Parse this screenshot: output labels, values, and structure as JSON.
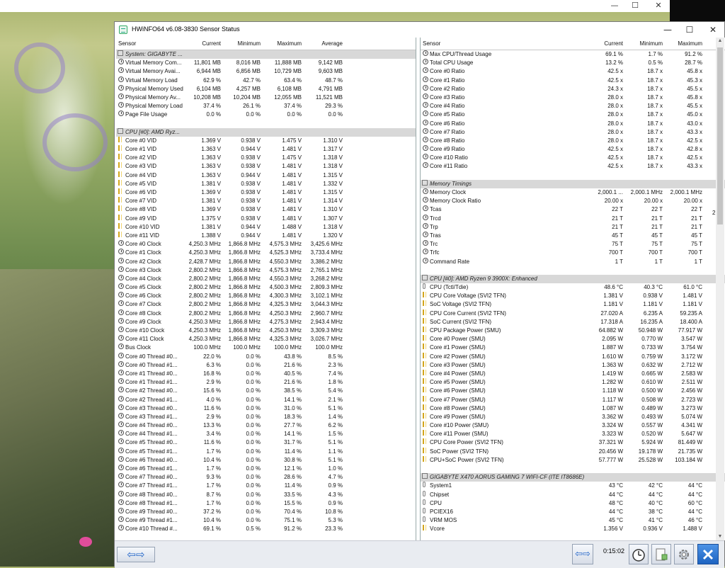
{
  "desktop": {
    "min_glyph": "—",
    "max_glyph": "☐",
    "close_glyph": "✕"
  },
  "window": {
    "title": "HWiNFO64 v6.08-3830 Sensor Status",
    "min_glyph": "—",
    "max_glyph": "☐",
    "close_glyph": "✕"
  },
  "left_pane": {
    "columns": [
      "Sensor",
      "Current",
      "Minimum",
      "Maximum",
      "Average"
    ],
    "rows": [
      {
        "type": "group",
        "label": "System: GIGABYTE ..."
      },
      {
        "icon": "clock-icon",
        "name": "Virtual Memory Com...",
        "cur": "11,801 MB",
        "min": "8,016 MB",
        "max": "11,888 MB",
        "avg": "9,142 MB"
      },
      {
        "icon": "clock-icon",
        "name": "Virtual Memory Avai...",
        "cur": "6,944 MB",
        "min": "6,856 MB",
        "max": "10,729 MB",
        "avg": "9,603 MB"
      },
      {
        "icon": "clock-icon",
        "name": "Virtual Memory Load",
        "cur": "62.9 %",
        "min": "42.7 %",
        "max": "63.4 %",
        "avg": "48.7 %"
      },
      {
        "icon": "clock-icon",
        "name": "Physical Memory Used",
        "cur": "6,104 MB",
        "min": "4,257 MB",
        "max": "6,108 MB",
        "avg": "4,791 MB"
      },
      {
        "icon": "clock-icon",
        "name": "Physical Memory Av...",
        "cur": "10,208 MB",
        "min": "10,204 MB",
        "max": "12,055 MB",
        "avg": "11,521 MB"
      },
      {
        "icon": "clock-icon",
        "name": "Physical Memory Load",
        "cur": "37.4 %",
        "min": "26.1 %",
        "max": "37.4 %",
        "avg": "29.3 %"
      },
      {
        "icon": "clock-icon",
        "name": "Page File Usage",
        "cur": "0.0 %",
        "min": "0.0 %",
        "max": "0.0 %",
        "avg": "0.0 %"
      },
      {
        "type": "blank"
      },
      {
        "type": "group",
        "label": "CPU [#0]: AMD Ryz..."
      },
      {
        "icon": "volt-icon",
        "name": "Core #0 VID",
        "cur": "1.369 V",
        "min": "0.938 V",
        "max": "1.475 V",
        "avg": "1.310 V"
      },
      {
        "icon": "volt-icon",
        "name": "Core #1 VID",
        "cur": "1.363 V",
        "min": "0.944 V",
        "max": "1.481 V",
        "avg": "1.317 V"
      },
      {
        "icon": "volt-icon",
        "name": "Core #2 VID",
        "cur": "1.363 V",
        "min": "0.938 V",
        "max": "1.475 V",
        "avg": "1.318 V"
      },
      {
        "icon": "volt-icon",
        "name": "Core #3 VID",
        "cur": "1.363 V",
        "min": "0.938 V",
        "max": "1.481 V",
        "avg": "1.318 V"
      },
      {
        "icon": "volt-icon",
        "name": "Core #4 VID",
        "cur": "1.363 V",
        "min": "0.944 V",
        "max": "1.481 V",
        "avg": "1.315 V"
      },
      {
        "icon": "volt-icon",
        "name": "Core #5 VID",
        "cur": "1.381 V",
        "min": "0.938 V",
        "max": "1.481 V",
        "avg": "1.332 V"
      },
      {
        "icon": "volt-icon",
        "name": "Core #6 VID",
        "cur": "1.369 V",
        "min": "0.938 V",
        "max": "1.481 V",
        "avg": "1.315 V"
      },
      {
        "icon": "volt-icon",
        "name": "Core #7 VID",
        "cur": "1.381 V",
        "min": "0.938 V",
        "max": "1.481 V",
        "avg": "1.314 V"
      },
      {
        "icon": "volt-icon",
        "name": "Core #8 VID",
        "cur": "1.369 V",
        "min": "0.938 V",
        "max": "1.481 V",
        "avg": "1.310 V"
      },
      {
        "icon": "volt-icon",
        "name": "Core #9 VID",
        "cur": "1.375 V",
        "min": "0.938 V",
        "max": "1.481 V",
        "avg": "1.307 V"
      },
      {
        "icon": "volt-icon",
        "name": "Core #10 VID",
        "cur": "1.381 V",
        "min": "0.944 V",
        "max": "1.488 V",
        "avg": "1.318 V"
      },
      {
        "icon": "volt-icon",
        "name": "Core #11 VID",
        "cur": "1.388 V",
        "min": "0.944 V",
        "max": "1.481 V",
        "avg": "1.320 V"
      },
      {
        "icon": "clock-icon",
        "name": "Core #0 Clock",
        "cur": "4,250.3 MHz",
        "min": "1,866.8 MHz",
        "max": "4,575.3 MHz",
        "avg": "3,425.6 MHz"
      },
      {
        "icon": "clock-icon",
        "name": "Core #1 Clock",
        "cur": "4,250.3 MHz",
        "min": "1,866.8 MHz",
        "max": "4,525.3 MHz",
        "avg": "3,733.4 MHz"
      },
      {
        "icon": "clock-icon",
        "name": "Core #2 Clock",
        "cur": "2,428.7 MHz",
        "min": "1,866.8 MHz",
        "max": "4,550.3 MHz",
        "avg": "3,386.2 MHz"
      },
      {
        "icon": "clock-icon",
        "name": "Core #3 Clock",
        "cur": "2,800.2 MHz",
        "min": "1,866.8 MHz",
        "max": "4,575.3 MHz",
        "avg": "2,765.1 MHz"
      },
      {
        "icon": "clock-icon",
        "name": "Core #4 Clock",
        "cur": "2,800.2 MHz",
        "min": "1,866.8 MHz",
        "max": "4,550.3 MHz",
        "avg": "3,268.2 MHz"
      },
      {
        "icon": "clock-icon",
        "name": "Core #5 Clock",
        "cur": "2,800.2 MHz",
        "min": "1,866.8 MHz",
        "max": "4,500.3 MHz",
        "avg": "2,809.3 MHz"
      },
      {
        "icon": "clock-icon",
        "name": "Core #6 Clock",
        "cur": "2,800.2 MHz",
        "min": "1,866.8 MHz",
        "max": "4,300.3 MHz",
        "avg": "3,102.1 MHz"
      },
      {
        "icon": "clock-icon",
        "name": "Core #7 Clock",
        "cur": "2,800.2 MHz",
        "min": "1,866.8 MHz",
        "max": "4,325.3 MHz",
        "avg": "3,044.3 MHz"
      },
      {
        "icon": "clock-icon",
        "name": "Core #8 Clock",
        "cur": "2,800.2 MHz",
        "min": "1,866.8 MHz",
        "max": "4,250.3 MHz",
        "avg": "2,960.7 MHz"
      },
      {
        "icon": "clock-icon",
        "name": "Core #9 Clock",
        "cur": "4,250.3 MHz",
        "min": "1,866.8 MHz",
        "max": "4,275.3 MHz",
        "avg": "2,943.4 MHz"
      },
      {
        "icon": "clock-icon",
        "name": "Core #10 Clock",
        "cur": "4,250.3 MHz",
        "min": "1,866.8 MHz",
        "max": "4,250.3 MHz",
        "avg": "3,309.3 MHz"
      },
      {
        "icon": "clock-icon",
        "name": "Core #11 Clock",
        "cur": "4,250.3 MHz",
        "min": "1,866.8 MHz",
        "max": "4,325.3 MHz",
        "avg": "3,026.7 MHz"
      },
      {
        "icon": "clock-icon",
        "name": "Bus Clock",
        "cur": "100.0 MHz",
        "min": "100.0 MHz",
        "max": "100.0 MHz",
        "avg": "100.0 MHz"
      },
      {
        "icon": "clock-icon",
        "name": "Core #0 Thread #0...",
        "cur": "22.0 %",
        "min": "0.0 %",
        "max": "43.8 %",
        "avg": "8.5 %"
      },
      {
        "icon": "clock-icon",
        "name": "Core #0 Thread #1...",
        "cur": "6.3 %",
        "min": "0.0 %",
        "max": "21.6 %",
        "avg": "2.3 %"
      },
      {
        "icon": "clock-icon",
        "name": "Core #1 Thread #0...",
        "cur": "16.8 %",
        "min": "0.0 %",
        "max": "40.5 %",
        "avg": "7.4 %"
      },
      {
        "icon": "clock-icon",
        "name": "Core #1 Thread #1...",
        "cur": "2.9 %",
        "min": "0.0 %",
        "max": "21.6 %",
        "avg": "1.8 %"
      },
      {
        "icon": "clock-icon",
        "name": "Core #2 Thread #0...",
        "cur": "15.6 %",
        "min": "0.0 %",
        "max": "38.5 %",
        "avg": "5.4 %"
      },
      {
        "icon": "clock-icon",
        "name": "Core #2 Thread #1...",
        "cur": "4.0 %",
        "min": "0.0 %",
        "max": "14.1 %",
        "avg": "2.1 %"
      },
      {
        "icon": "clock-icon",
        "name": "Core #3 Thread #0...",
        "cur": "11.6 %",
        "min": "0.0 %",
        "max": "31.0 %",
        "avg": "5.1 %"
      },
      {
        "icon": "clock-icon",
        "name": "Core #3 Thread #1...",
        "cur": "2.9 %",
        "min": "0.0 %",
        "max": "18.3 %",
        "avg": "1.4 %"
      },
      {
        "icon": "clock-icon",
        "name": "Core #4 Thread #0...",
        "cur": "13.3 %",
        "min": "0.0 %",
        "max": "27.7 %",
        "avg": "6.2 %"
      },
      {
        "icon": "clock-icon",
        "name": "Core #4 Thread #1...",
        "cur": "3.4 %",
        "min": "0.0 %",
        "max": "14.1 %",
        "avg": "1.5 %"
      },
      {
        "icon": "clock-icon",
        "name": "Core #5 Thread #0...",
        "cur": "11.6 %",
        "min": "0.0 %",
        "max": "31.7 %",
        "avg": "5.1 %"
      },
      {
        "icon": "clock-icon",
        "name": "Core #5 Thread #1...",
        "cur": "1.7 %",
        "min": "0.0 %",
        "max": "11.4 %",
        "avg": "1.1 %"
      },
      {
        "icon": "clock-icon",
        "name": "Core #6 Thread #0...",
        "cur": "10.4 %",
        "min": "0.0 %",
        "max": "30.8 %",
        "avg": "5.1 %"
      },
      {
        "icon": "clock-icon",
        "name": "Core #6 Thread #1...",
        "cur": "1.7 %",
        "min": "0.0 %",
        "max": "12.1 %",
        "avg": "1.0 %"
      },
      {
        "icon": "clock-icon",
        "name": "Core #7 Thread #0...",
        "cur": "9.3 %",
        "min": "0.0 %",
        "max": "28.6 %",
        "avg": "4.7 %"
      },
      {
        "icon": "clock-icon",
        "name": "Core #7 Thread #1...",
        "cur": "1.7 %",
        "min": "0.0 %",
        "max": "11.4 %",
        "avg": "0.9 %"
      },
      {
        "icon": "clock-icon",
        "name": "Core #8 Thread #0...",
        "cur": "8.7 %",
        "min": "0.0 %",
        "max": "33.5 %",
        "avg": "4.3 %"
      },
      {
        "icon": "clock-icon",
        "name": "Core #8 Thread #1...",
        "cur": "1.7 %",
        "min": "0.0 %",
        "max": "15.5 %",
        "avg": "0.9 %"
      },
      {
        "icon": "clock-icon",
        "name": "Core #9 Thread #0...",
        "cur": "37.2 %",
        "min": "0.0 %",
        "max": "70.4 %",
        "avg": "10.8 %"
      },
      {
        "icon": "clock-icon",
        "name": "Core #9 Thread #1...",
        "cur": "10.4 %",
        "min": "0.0 %",
        "max": "75.1 %",
        "avg": "5.3 %"
      },
      {
        "icon": "clock-icon",
        "name": "Core #10 Thread #...",
        "cur": "69.1 %",
        "min": "0.5 %",
        "max": "91.2 %",
        "avg": "23.3 %"
      }
    ]
  },
  "right_pane": {
    "columns": [
      "Sensor",
      "Current",
      "Minimum",
      "Maximum"
    ],
    "rows": [
      {
        "icon": "clock-icon",
        "name": "Max CPU/Thread Usage",
        "cur": "69.1 %",
        "min": "1.7 %",
        "max": "91.2 %"
      },
      {
        "icon": "clock-icon",
        "name": "Total CPU Usage",
        "cur": "13.2 %",
        "min": "0.5 %",
        "max": "28.7 %"
      },
      {
        "icon": "clock-icon",
        "name": "Core #0 Ratio",
        "cur": "42.5 x",
        "min": "18.7 x",
        "max": "45.8 x"
      },
      {
        "icon": "clock-icon",
        "name": "Core #1 Ratio",
        "cur": "42.5 x",
        "min": "18.7 x",
        "max": "45.3 x"
      },
      {
        "icon": "clock-icon",
        "name": "Core #2 Ratio",
        "cur": "24.3 x",
        "min": "18.7 x",
        "max": "45.5 x"
      },
      {
        "icon": "clock-icon",
        "name": "Core #3 Ratio",
        "cur": "28.0 x",
        "min": "18.7 x",
        "max": "45.8 x"
      },
      {
        "icon": "clock-icon",
        "name": "Core #4 Ratio",
        "cur": "28.0 x",
        "min": "18.7 x",
        "max": "45.5 x"
      },
      {
        "icon": "clock-icon",
        "name": "Core #5 Ratio",
        "cur": "28.0 x",
        "min": "18.7 x",
        "max": "45.0 x"
      },
      {
        "icon": "clock-icon",
        "name": "Core #6 Ratio",
        "cur": "28.0 x",
        "min": "18.7 x",
        "max": "43.0 x"
      },
      {
        "icon": "clock-icon",
        "name": "Core #7 Ratio",
        "cur": "28.0 x",
        "min": "18.7 x",
        "max": "43.3 x"
      },
      {
        "icon": "clock-icon",
        "name": "Core #8 Ratio",
        "cur": "28.0 x",
        "min": "18.7 x",
        "max": "42.5 x"
      },
      {
        "icon": "clock-icon",
        "name": "Core #9 Ratio",
        "cur": "42.5 x",
        "min": "18.7 x",
        "max": "42.8 x"
      },
      {
        "icon": "clock-icon",
        "name": "Core #10 Ratio",
        "cur": "42.5 x",
        "min": "18.7 x",
        "max": "42.5 x"
      },
      {
        "icon": "clock-icon",
        "name": "Core #11 Ratio",
        "cur": "42.5 x",
        "min": "18.7 x",
        "max": "43.3 x"
      },
      {
        "type": "blank"
      },
      {
        "type": "group",
        "label": "Memory Timings"
      },
      {
        "icon": "clock-icon",
        "name": "Memory Clock",
        "cur": "2,000.1 ...",
        "min": "2,000.1 MHz",
        "max": "2,000.1 MHz"
      },
      {
        "icon": "clock-icon",
        "name": "Memory Clock Ratio",
        "cur": "20.00 x",
        "min": "20.00 x",
        "max": "20.00 x"
      },
      {
        "icon": "clock-icon",
        "name": "Tcas",
        "cur": "22 T",
        "min": "22 T",
        "max": "22 T"
      },
      {
        "icon": "clock-icon",
        "name": "Trcd",
        "cur": "21 T",
        "min": "21 T",
        "max": "21 T"
      },
      {
        "icon": "clock-icon",
        "name": "Trp",
        "cur": "21 T",
        "min": "21 T",
        "max": "21 T"
      },
      {
        "icon": "clock-icon",
        "name": "Tras",
        "cur": "45 T",
        "min": "45 T",
        "max": "45 T"
      },
      {
        "icon": "clock-icon",
        "name": "Trc",
        "cur": "75 T",
        "min": "75 T",
        "max": "75 T"
      },
      {
        "icon": "clock-icon",
        "name": "Trfc",
        "cur": "700 T",
        "min": "700 T",
        "max": "700 T"
      },
      {
        "icon": "clock-icon",
        "name": "Command Rate",
        "cur": "1 T",
        "min": "1 T",
        "max": "1 T"
      },
      {
        "type": "blank"
      },
      {
        "type": "group",
        "label": "CPU [#0]: AMD Ryzen 9 3900X: Enhanced"
      },
      {
        "icon": "temp-icon",
        "name": "CPU (Tctl/Tdie)",
        "cur": "48.6 °C",
        "min": "40.3 °C",
        "max": "61.0 °C"
      },
      {
        "icon": "volt-icon",
        "name": "CPU Core Voltage (SVI2 TFN)",
        "cur": "1.381 V",
        "min": "0.938 V",
        "max": "1.481 V"
      },
      {
        "icon": "volt-icon",
        "name": "SoC Voltage (SVI2 TFN)",
        "cur": "1.181 V",
        "min": "1.181 V",
        "max": "1.181 V"
      },
      {
        "icon": "volt-icon",
        "name": "CPU Core Current (SVI2 TFN)",
        "cur": "27.020 A",
        "min": "6.235 A",
        "max": "59.235 A"
      },
      {
        "icon": "volt-icon",
        "name": "SoC Current (SVI2 TFN)",
        "cur": "17.318 A",
        "min": "16.235 A",
        "max": "18.400 A"
      },
      {
        "icon": "volt-icon",
        "name": "CPU Package Power (SMU)",
        "cur": "64.882 W",
        "min": "50.948 W",
        "max": "77.917 W"
      },
      {
        "icon": "volt-icon",
        "name": "Core #0 Power (SMU)",
        "cur": "2.095 W",
        "min": "0.770 W",
        "max": "3.547 W"
      },
      {
        "icon": "volt-icon",
        "name": "Core #1 Power (SMU)",
        "cur": "1.887 W",
        "min": "0.733 W",
        "max": "3.754 W"
      },
      {
        "icon": "volt-icon",
        "name": "Core #2 Power (SMU)",
        "cur": "1.610 W",
        "min": "0.759 W",
        "max": "3.172 W"
      },
      {
        "icon": "volt-icon",
        "name": "Core #3 Power (SMU)",
        "cur": "1.363 W",
        "min": "0.632 W",
        "max": "2.712 W"
      },
      {
        "icon": "volt-icon",
        "name": "Core #4 Power (SMU)",
        "cur": "1.419 W",
        "min": "0.665 W",
        "max": "2.583 W"
      },
      {
        "icon": "volt-icon",
        "name": "Core #5 Power (SMU)",
        "cur": "1.282 W",
        "min": "0.610 W",
        "max": "2.511 W"
      },
      {
        "icon": "volt-icon",
        "name": "Core #6 Power (SMU)",
        "cur": "1.118 W",
        "min": "0.500 W",
        "max": "2.456 W"
      },
      {
        "icon": "volt-icon",
        "name": "Core #7 Power (SMU)",
        "cur": "1.117 W",
        "min": "0.508 W",
        "max": "2.723 W"
      },
      {
        "icon": "volt-icon",
        "name": "Core #8 Power (SMU)",
        "cur": "1.087 W",
        "min": "0.489 W",
        "max": "3.273 W"
      },
      {
        "icon": "volt-icon",
        "name": "Core #9 Power (SMU)",
        "cur": "3.362 W",
        "min": "0.493 W",
        "max": "5.074 W"
      },
      {
        "icon": "volt-icon",
        "name": "Core #10 Power (SMU)",
        "cur": "3.324 W",
        "min": "0.557 W",
        "max": "4.341 W"
      },
      {
        "icon": "volt-icon",
        "name": "Core #11 Power (SMU)",
        "cur": "3.323 W",
        "min": "0.520 W",
        "max": "5.647 W"
      },
      {
        "icon": "volt-icon",
        "name": "CPU Core Power (SVI2 TFN)",
        "cur": "37.321 W",
        "min": "5.924 W",
        "max": "81.449 W"
      },
      {
        "icon": "volt-icon",
        "name": "SoC Power (SVI2 TFN)",
        "cur": "20.456 W",
        "min": "19.178 W",
        "max": "21.735 W"
      },
      {
        "icon": "volt-icon",
        "name": "CPU+SoC Power (SVI2 TFN)",
        "cur": "57.777 W",
        "min": "25.528 W",
        "max": "103.184 W"
      },
      {
        "type": "blank"
      },
      {
        "type": "group",
        "label": "GIGABYTE X470 AORUS GAMING 7 WIFI-CF (ITE IT8686E)"
      },
      {
        "icon": "temp-icon",
        "name": "System1",
        "cur": "43 °C",
        "min": "42 °C",
        "max": "44 °C"
      },
      {
        "icon": "temp-icon",
        "name": "Chipset",
        "cur": "44 °C",
        "min": "44 °C",
        "max": "44 °C"
      },
      {
        "icon": "temp-icon",
        "name": "CPU",
        "cur": "48 °C",
        "min": "40 °C",
        "max": "60 °C"
      },
      {
        "icon": "temp-icon",
        "name": "PCIEX16",
        "cur": "44 °C",
        "min": "38 °C",
        "max": "44 °C"
      },
      {
        "icon": "temp-icon",
        "name": "VRM MOS",
        "cur": "45 °C",
        "min": "41 °C",
        "max": "46 °C"
      },
      {
        "icon": "volt-icon",
        "name": "Vcore",
        "cur": "1.356 V",
        "min": "0.936 V",
        "max": "1.488 V"
      }
    ],
    "overflow_col": "2"
  },
  "toolbar": {
    "left_arrows": "⇦⇨",
    "right_arrows": "⇦⇨",
    "timer": "0:15:02"
  },
  "colors": {
    "group_bg": "#d8d8d8",
    "accent": "#1f63c8",
    "close_btn": "#2a78d6"
  }
}
